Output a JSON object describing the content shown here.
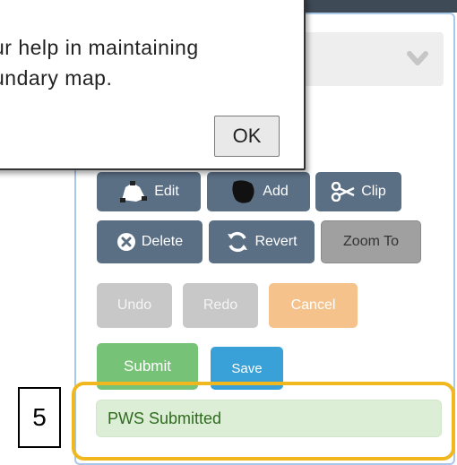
{
  "dialog": {
    "message_line1": "ur help in maintaining",
    "message_line2": "undary map.",
    "ok_label": "OK"
  },
  "panel": {
    "chevron_icon": "chevron-down-icon"
  },
  "toolbar": {
    "edit_label": "Edit",
    "add_label": "Add",
    "clip_label": "Clip",
    "delete_label": "Delete",
    "revert_label": "Revert",
    "zoom_to_label": "Zoom To",
    "undo_label": "Undo",
    "redo_label": "Redo",
    "cancel_label": "Cancel",
    "submit_label": "Submit",
    "save_label": "Save"
  },
  "status": {
    "text": "PWS Submitted"
  },
  "annotation": {
    "step_number": "5",
    "highlight_color": "#f0b81e"
  }
}
